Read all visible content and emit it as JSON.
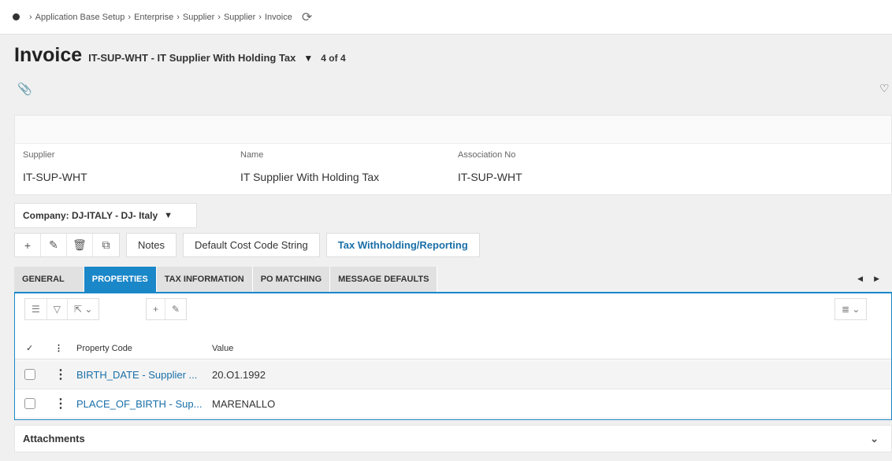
{
  "breadcrumb": [
    "Application Base Setup",
    "Enterprise",
    "Supplier",
    "Supplier",
    "Invoice"
  ],
  "header": {
    "title": "Invoice",
    "record": "IT-SUP-WHT - IT Supplier With Holding Tax",
    "count": "4 of 4"
  },
  "fields": {
    "supplier": {
      "label": "Supplier",
      "value": "IT-SUP-WHT"
    },
    "name": {
      "label": "Name",
      "value": "IT Supplier With Holding Tax"
    },
    "association": {
      "label": "Association No",
      "value": "IT-SUP-WHT"
    }
  },
  "company": "Company: DJ-ITALY - DJ- Italy",
  "toolbar": {
    "notes": "Notes",
    "cost_code": "Default Cost Code String",
    "tax": "Tax Withholding/Reporting"
  },
  "tabs": [
    "GENERAL",
    "PROPERTIES",
    "TAX INFORMATION",
    "PO MATCHING",
    "MESSAGE DEFAULTS"
  ],
  "table": {
    "headers": [
      "Property Code",
      "Value"
    ],
    "rows": [
      {
        "code": "BIRTH_DATE - Supplier ...",
        "value": "20.O1.1992"
      },
      {
        "code": "PLACE_OF_BIRTH - Sup...",
        "value": "MARENALLO"
      }
    ]
  },
  "attachments": "Attachments",
  "colors": {
    "accent": "#1a87c9",
    "link": "#1a6fa8"
  }
}
